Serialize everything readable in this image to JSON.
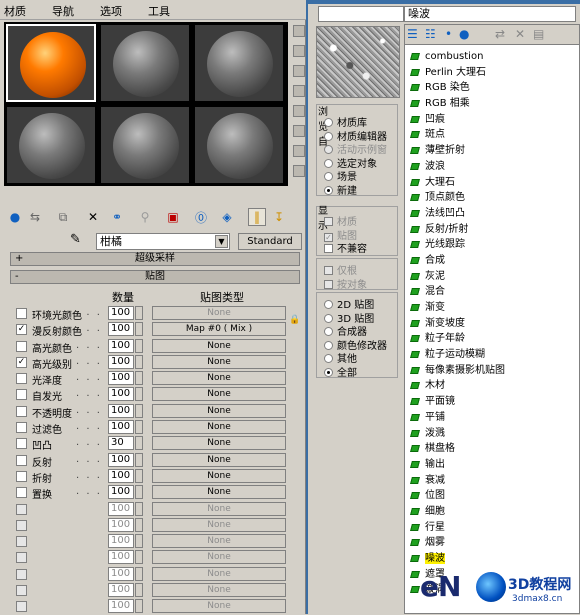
{
  "material_editor": {
    "menu": [
      "材质",
      "导航",
      "选项",
      "工具"
    ],
    "material_name": "柑橘",
    "material_type_button": "Standard",
    "rollouts": {
      "supersampling": "超级采样",
      "maps": "贴图"
    },
    "maps_columns": {
      "amount": "数量",
      "map_type": "贴图类型"
    },
    "maps": [
      {
        "checked": false,
        "name": "环境光颜色",
        "amount": "100",
        "map": "None",
        "dim": false,
        "map_dim": true
      },
      {
        "checked": true,
        "name": "漫反射颜色",
        "amount": "100",
        "map": "Map #0  ( Mix )",
        "dim": false,
        "map_dim": false
      },
      {
        "checked": false,
        "name": "高光颜色",
        "amount": "100",
        "map": "None",
        "dim": false,
        "map_dim": false
      },
      {
        "checked": true,
        "name": "高光级别",
        "amount": "100",
        "map": "None",
        "dim": false,
        "map_dim": false
      },
      {
        "checked": false,
        "name": "光泽度",
        "amount": "100",
        "map": "None",
        "dim": false,
        "map_dim": false
      },
      {
        "checked": false,
        "name": "自发光",
        "amount": "100",
        "map": "None",
        "dim": false,
        "map_dim": false
      },
      {
        "checked": false,
        "name": "不透明度",
        "amount": "100",
        "map": "None",
        "dim": false,
        "map_dim": false
      },
      {
        "checked": false,
        "name": "过滤色",
        "amount": "100",
        "map": "None",
        "dim": false,
        "map_dim": false
      },
      {
        "checked": false,
        "name": "凹凸",
        "amount": "30",
        "map": "None",
        "dim": false,
        "map_dim": false
      },
      {
        "checked": false,
        "name": "反射",
        "amount": "100",
        "map": "None",
        "dim": false,
        "map_dim": false
      },
      {
        "checked": false,
        "name": "折射",
        "amount": "100",
        "map": "None",
        "dim": false,
        "map_dim": false
      },
      {
        "checked": false,
        "name": "置换",
        "amount": "100",
        "map": "None",
        "dim": false,
        "map_dim": false
      },
      {
        "checked": false,
        "name": "",
        "amount": "100",
        "map": "None",
        "dim": true,
        "map_dim": true
      },
      {
        "checked": false,
        "name": "",
        "amount": "100",
        "map": "None",
        "dim": true,
        "map_dim": true
      },
      {
        "checked": false,
        "name": "",
        "amount": "100",
        "map": "None",
        "dim": true,
        "map_dim": true
      },
      {
        "checked": false,
        "name": "",
        "amount": "100",
        "map": "None",
        "dim": true,
        "map_dim": true
      },
      {
        "checked": false,
        "name": "",
        "amount": "100",
        "map": "None",
        "dim": true,
        "map_dim": true
      },
      {
        "checked": false,
        "name": "",
        "amount": "100",
        "map": "None",
        "dim": true,
        "map_dim": true
      },
      {
        "checked": false,
        "name": "",
        "amount": "100",
        "map": "None",
        "dim": true,
        "map_dim": true
      }
    ]
  },
  "browser": {
    "current_map": "噪波",
    "browse_from": {
      "title": "浏览自",
      "options": [
        {
          "label": "材质库",
          "selected": false,
          "dim": false
        },
        {
          "label": "材质编辑器",
          "selected": false,
          "dim": false
        },
        {
          "label": "活动示例窗",
          "selected": false,
          "dim": true
        },
        {
          "label": "选定对象",
          "selected": false,
          "dim": false
        },
        {
          "label": "场景",
          "selected": false,
          "dim": false
        },
        {
          "label": "新建",
          "selected": true,
          "dim": false
        }
      ]
    },
    "show": {
      "title": "显示",
      "options": [
        {
          "label": "材质",
          "checked": false,
          "dim": true
        },
        {
          "label": "贴图",
          "checked": true,
          "dim": true
        },
        {
          "label": "不兼容",
          "checked": false,
          "dim": false
        }
      ]
    },
    "filter_options": [
      {
        "label": "仅根",
        "dim": true
      },
      {
        "label": "按对象",
        "dim": true
      }
    ],
    "map_types": {
      "options": [
        {
          "label": "2D 贴图",
          "selected": false
        },
        {
          "label": "3D 贴图",
          "selected": false
        },
        {
          "label": "合成器",
          "selected": false
        },
        {
          "label": "颜色修改器",
          "selected": false
        },
        {
          "label": "其他",
          "selected": false
        },
        {
          "label": "全部",
          "selected": true
        }
      ]
    },
    "list": [
      "combustion",
      "Perlin 大理石",
      "RGB 染色",
      "RGB 相乘",
      "凹痕",
      "斑点",
      "薄壁折射",
      "波浪",
      "大理石",
      "顶点颜色",
      "法线凹凸",
      "反射/折射",
      "光线跟踪",
      "合成",
      "灰泥",
      "混合",
      "渐变",
      "渐变坡度",
      "粒子年龄",
      "粒子运动模糊",
      "每像素摄影机贴图",
      "木材",
      "平面镜",
      "平铺",
      "泼溅",
      "棋盘格",
      "输出",
      "衰减",
      "位图",
      "细胞",
      "行星",
      "烟雾",
      "噪波",
      "遮罩",
      "漩涡"
    ],
    "selected_item": "噪波"
  },
  "watermark": {
    "en": "eN",
    "cn": "3D教程网",
    "url": "3dmax8.cn"
  },
  "colors": {
    "list_icon": "#1fa11f",
    "selection_highlight": "#fff200",
    "title_accent": "#3a6ea5",
    "active_sphere": "#ff7a00"
  }
}
